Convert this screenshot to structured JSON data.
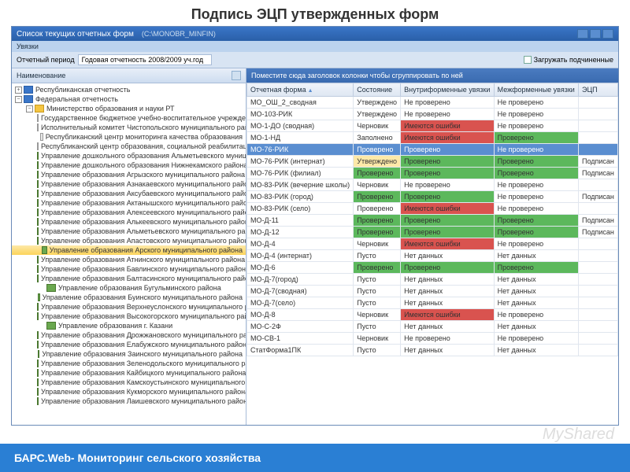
{
  "page": {
    "title": "Подпись ЭЦП утвержденных форм",
    "footer": "БАРС.Web- Мониторинг сельского хозяйства",
    "watermark": "MyShared"
  },
  "window": {
    "title": "Список текущих отчетных форм",
    "path": "(C:\\MONOBR_MINFIN)"
  },
  "subbar": "Увязки",
  "period": {
    "label": "Отчетный период",
    "value": "Годовая отчетность 2008/2009 уч.год",
    "checkbox_label": "Загружать подчиненные"
  },
  "tree": {
    "header": "Наименование",
    "items": [
      {
        "lvl": 1,
        "exp": "+",
        "ico": "folder-blue",
        "label": "Республиканская отчетность",
        "sel": false
      },
      {
        "lvl": 1,
        "exp": "−",
        "ico": "folder-blue",
        "label": "Федеральная отчетность",
        "sel": false
      },
      {
        "lvl": 2,
        "exp": "−",
        "ico": "folder-yel",
        "label": "Министерство образования и науки РТ",
        "sel": false
      },
      {
        "lvl": 3,
        "exp": "",
        "ico": "doc",
        "label": "Государственное бюджетное учебно-воспитательное учреждение ...",
        "sel": false
      },
      {
        "lvl": 3,
        "exp": "",
        "ico": "doc",
        "label": "Исполнительный комитет Чистопольского муниципального района",
        "sel": false
      },
      {
        "lvl": 3,
        "exp": "",
        "ico": "doc",
        "label": "Республиканский центр мониторинга качества образования",
        "sel": false
      },
      {
        "lvl": 3,
        "exp": "",
        "ico": "doc",
        "label": "Республиканский центр образования, социальной реабилитации и п...",
        "sel": false
      },
      {
        "lvl": 3,
        "exp": "",
        "ico": "org",
        "label": "Управление дошкольного образования Альметьевского муниципаль...",
        "sel": false
      },
      {
        "lvl": 3,
        "exp": "",
        "ico": "org",
        "label": "Управление дошкольного образования Нижнекамского района",
        "sel": false
      },
      {
        "lvl": 3,
        "exp": "",
        "ico": "org",
        "label": "Управление образования Агрызского муниципального района",
        "sel": false
      },
      {
        "lvl": 3,
        "exp": "",
        "ico": "org",
        "label": "Управление образования Азнакаевского муниципального района",
        "sel": false
      },
      {
        "lvl": 3,
        "exp": "",
        "ico": "org",
        "label": "Управление образования Аксубаевского муниципального района",
        "sel": false
      },
      {
        "lvl": 3,
        "exp": "",
        "ico": "org",
        "label": "Управление образования Актанышского муниципального района",
        "sel": false
      },
      {
        "lvl": 3,
        "exp": "",
        "ico": "org",
        "label": "Управление образования Алексеевского муниципального района",
        "sel": false
      },
      {
        "lvl": 3,
        "exp": "",
        "ico": "org",
        "label": "Управление образования Алькеевского муниципального района",
        "sel": false
      },
      {
        "lvl": 3,
        "exp": "",
        "ico": "org",
        "label": "Управление образования Альметьевского муниципального района",
        "sel": false
      },
      {
        "lvl": 3,
        "exp": "",
        "ico": "org",
        "label": "Управление образования Апастовского муниципального района",
        "sel": false
      },
      {
        "lvl": 3,
        "exp": "",
        "ico": "org",
        "label": "Управление образования Арского муниципального района",
        "sel": true
      },
      {
        "lvl": 3,
        "exp": "",
        "ico": "org",
        "label": "Управление образования Атнинского муниципального района",
        "sel": false
      },
      {
        "lvl": 3,
        "exp": "",
        "ico": "org",
        "label": "Управление образования Бавлинского муниципального района",
        "sel": false
      },
      {
        "lvl": 3,
        "exp": "",
        "ico": "org",
        "label": "Управление образования Балтасинского муниципального района",
        "sel": false
      },
      {
        "lvl": 3,
        "exp": "",
        "ico": "org",
        "label": "Управление образования Бугульминского района",
        "sel": false
      },
      {
        "lvl": 3,
        "exp": "",
        "ico": "org",
        "label": "Управление образования Буинского муниципального района",
        "sel": false
      },
      {
        "lvl": 3,
        "exp": "",
        "ico": "org",
        "label": "Управление образования Верхнеуслонского муниципального района",
        "sel": false
      },
      {
        "lvl": 3,
        "exp": "",
        "ico": "org",
        "label": "Управление образования Высокогорского муниципального района",
        "sel": false
      },
      {
        "lvl": 3,
        "exp": "",
        "ico": "org",
        "label": "Управление образования г. Казани",
        "sel": false
      },
      {
        "lvl": 3,
        "exp": "",
        "ico": "org",
        "label": "Управление образования Дрожжановского муниципального района",
        "sel": false
      },
      {
        "lvl": 3,
        "exp": "",
        "ico": "org",
        "label": "Управление образования Елабужского муниципального района",
        "sel": false
      },
      {
        "lvl": 3,
        "exp": "",
        "ico": "org",
        "label": "Управление образования Заинского муниципального района",
        "sel": false
      },
      {
        "lvl": 3,
        "exp": "",
        "ico": "org",
        "label": "Управление образования Зеленодольского муниципального района",
        "sel": false
      },
      {
        "lvl": 3,
        "exp": "",
        "ico": "org",
        "label": "Управление образования Кайбицкого муниципального района",
        "sel": false
      },
      {
        "lvl": 3,
        "exp": "",
        "ico": "org",
        "label": "Управление образования Камскоустьинского муниципального района",
        "sel": false
      },
      {
        "lvl": 3,
        "exp": "",
        "ico": "org",
        "label": "Управление образования Кукморского муниципального района",
        "sel": false
      },
      {
        "lvl": 3,
        "exp": "",
        "ico": "org",
        "label": "Управление образования Лаишевского муниципального района",
        "sel": false
      }
    ]
  },
  "grid": {
    "group_hint": "Поместите сюда заголовок колонки чтобы сгруппировать по ней",
    "columns": [
      "Отчетная форма",
      "Состояние",
      "Внутриформенные увязки",
      "Межформенные увязки",
      "ЭЦП"
    ],
    "rows": [
      {
        "form": "МО_ОШ_2_сводная",
        "state": "Утверждено",
        "state_cls": "",
        "intra": "Не проверено",
        "intra_cls": "",
        "inter": "Не проверено",
        "inter_cls": "",
        "ecp": "",
        "sel": false
      },
      {
        "form": "МО-103-РИК",
        "state": "Утверждено",
        "state_cls": "",
        "intra": "Не проверено",
        "intra_cls": "",
        "inter": "Не проверено",
        "inter_cls": "",
        "ecp": "",
        "sel": false
      },
      {
        "form": "МО-1-ДО (сводная)",
        "state": "Черновик",
        "state_cls": "",
        "intra": "Имеются ошибки",
        "intra_cls": "status-red",
        "inter": "Не проверено",
        "inter_cls": "",
        "ecp": "",
        "sel": false
      },
      {
        "form": "МО-1-НД",
        "state": "Заполнено",
        "state_cls": "",
        "intra": "Имеются ошибки",
        "intra_cls": "status-red",
        "inter": "Проверено",
        "inter_cls": "status-green",
        "ecp": "",
        "sel": false
      },
      {
        "form": "МО-76-РИК",
        "state": "Проверено",
        "state_cls": "",
        "intra": "Проверено",
        "intra_cls": "",
        "inter": "Не проверено",
        "inter_cls": "",
        "ecp": "",
        "sel": true
      },
      {
        "form": "МО-76-РИК (интернат)",
        "state": "Утверждено",
        "state_cls": "status-yellow",
        "intra": "Проверено",
        "intra_cls": "status-green",
        "inter": "Проверено",
        "inter_cls": "status-green",
        "ecp": "Подписан",
        "sel": false
      },
      {
        "form": "МО-76-РИК (филиал)",
        "state": "Проверено",
        "state_cls": "status-green",
        "intra": "Проверено",
        "intra_cls": "status-green",
        "inter": "Проверено",
        "inter_cls": "status-green",
        "ecp": "Подписан",
        "sel": false
      },
      {
        "form": "МО-83-РИК (вечерние школы)",
        "state": "Черновик",
        "state_cls": "",
        "intra": "Не проверено",
        "intra_cls": "",
        "inter": "Не проверено",
        "inter_cls": "",
        "ecp": "",
        "sel": false
      },
      {
        "form": "МО-83-РИК (город)",
        "state": "Проверено",
        "state_cls": "status-green",
        "intra": "Проверено",
        "intra_cls": "status-green",
        "inter": "Не проверено",
        "inter_cls": "",
        "ecp": "Подписан",
        "sel": false
      },
      {
        "form": "МО-83-РИК (село)",
        "state": "Проверено",
        "state_cls": "",
        "intra": "Имеются ошибки",
        "intra_cls": "status-red",
        "inter": "Не проверено",
        "inter_cls": "",
        "ecp": "",
        "sel": false
      },
      {
        "form": "МО-Д-11",
        "state": "Проверено",
        "state_cls": "status-green",
        "intra": "Проверено",
        "intra_cls": "status-green",
        "inter": "Проверено",
        "inter_cls": "status-green",
        "ecp": "Подписан",
        "sel": false
      },
      {
        "form": "МО-Д-12",
        "state": "Проверено",
        "state_cls": "status-green",
        "intra": "Проверено",
        "intra_cls": "status-green",
        "inter": "Проверено",
        "inter_cls": "status-green",
        "ecp": "Подписан",
        "sel": false
      },
      {
        "form": "МО-Д-4",
        "state": "Черновик",
        "state_cls": "",
        "intra": "Имеются ошибки",
        "intra_cls": "status-red",
        "inter": "Не проверено",
        "inter_cls": "",
        "ecp": "",
        "sel": false
      },
      {
        "form": "МО-Д-4 (интернат)",
        "state": "Пусто",
        "state_cls": "",
        "intra": "Нет данных",
        "intra_cls": "",
        "inter": "Нет данных",
        "inter_cls": "",
        "ecp": "",
        "sel": false
      },
      {
        "form": "МО-Д-6",
        "state": "Проверено",
        "state_cls": "status-green",
        "intra": "Проверено",
        "intra_cls": "status-green",
        "inter": "Проверено",
        "inter_cls": "status-green",
        "ecp": "",
        "sel": false
      },
      {
        "form": "МО-Д-7(город)",
        "state": "Пусто",
        "state_cls": "",
        "intra": "Нет данных",
        "intra_cls": "",
        "inter": "Нет данных",
        "inter_cls": "",
        "ecp": "",
        "sel": false
      },
      {
        "form": "МО-Д-7(сводная)",
        "state": "Пусто",
        "state_cls": "",
        "intra": "Нет данных",
        "intra_cls": "",
        "inter": "Нет данных",
        "inter_cls": "",
        "ecp": "",
        "sel": false
      },
      {
        "form": "МО-Д-7(село)",
        "state": "Пусто",
        "state_cls": "",
        "intra": "Нет данных",
        "intra_cls": "",
        "inter": "Нет данных",
        "inter_cls": "",
        "ecp": "",
        "sel": false
      },
      {
        "form": "МО-Д-8",
        "state": "Черновик",
        "state_cls": "",
        "intra": "Имеются ошибки",
        "intra_cls": "status-red",
        "inter": "Не проверено",
        "inter_cls": "",
        "ecp": "",
        "sel": false
      },
      {
        "form": "МО-С-2Ф",
        "state": "Пусто",
        "state_cls": "",
        "intra": "Нет данных",
        "intra_cls": "",
        "inter": "Нет данных",
        "inter_cls": "",
        "ecp": "",
        "sel": false
      },
      {
        "form": "МО-СВ-1",
        "state": "Черновик",
        "state_cls": "",
        "intra": "Не проверено",
        "intra_cls": "",
        "inter": "Не проверено",
        "inter_cls": "",
        "ecp": "",
        "sel": false
      },
      {
        "form": "СтатФорма1ПК",
        "state": "Пусто",
        "state_cls": "",
        "intra": "Нет данных",
        "intra_cls": "",
        "inter": "Нет данных",
        "inter_cls": "",
        "ecp": "",
        "sel": false
      }
    ]
  }
}
